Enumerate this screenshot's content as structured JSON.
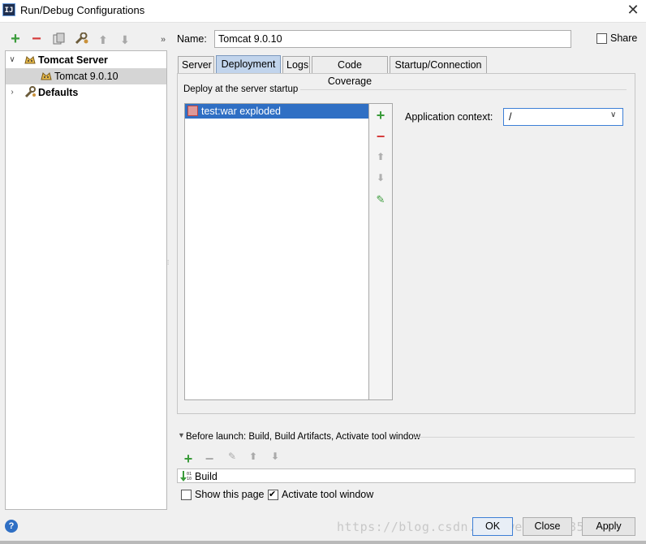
{
  "window": {
    "title": "Run/Debug Configurations",
    "app_icon_text": "IJ"
  },
  "toolbar": {
    "add": "+",
    "remove": "−",
    "up": "⬆",
    "down": "⬇",
    "more": "»"
  },
  "tree": {
    "items": [
      {
        "label": "Tomcat Server",
        "expanded": true,
        "icon": "tomcat-icon"
      },
      {
        "label": "Tomcat 9.0.10",
        "selected": true,
        "icon": "tomcat-icon"
      },
      {
        "label": "Defaults",
        "expanded": false,
        "icon": "wrench-icon"
      }
    ]
  },
  "name": {
    "label": "Name:",
    "value": "Tomcat 9.0.10"
  },
  "share": {
    "label": "Share",
    "checked": false
  },
  "tabs": [
    {
      "label": "Server"
    },
    {
      "label": "Deployment",
      "active": true
    },
    {
      "label": "Logs"
    },
    {
      "label": "Code Coverage"
    },
    {
      "label": "Startup/Connection"
    }
  ],
  "deploy": {
    "group_title": "Deploy at the server startup",
    "items": [
      {
        "label": "test:war exploded",
        "selected": true,
        "icon": "artifact-icon"
      }
    ],
    "context_label": "Application context:",
    "context_value": "/"
  },
  "before_launch": {
    "label": "Before launch: Build, Build Artifacts, Activate tool window",
    "items": [
      {
        "label": "Build",
        "icon": "build-icon"
      }
    ]
  },
  "options": {
    "show_page": {
      "label": "Show this page",
      "checked": false
    },
    "activate_tool": {
      "label": "Activate tool window",
      "checked": true
    }
  },
  "buttons": {
    "ok": "OK",
    "close": "Close",
    "apply": "Apply"
  },
  "watermark": "https://blog.csdn.net/weixin_38502225",
  "colors": {
    "selection": "#2f6fc4",
    "tab_active": "#c1d4ec",
    "add": "#3a9b3a",
    "remove": "#d63b3b"
  }
}
